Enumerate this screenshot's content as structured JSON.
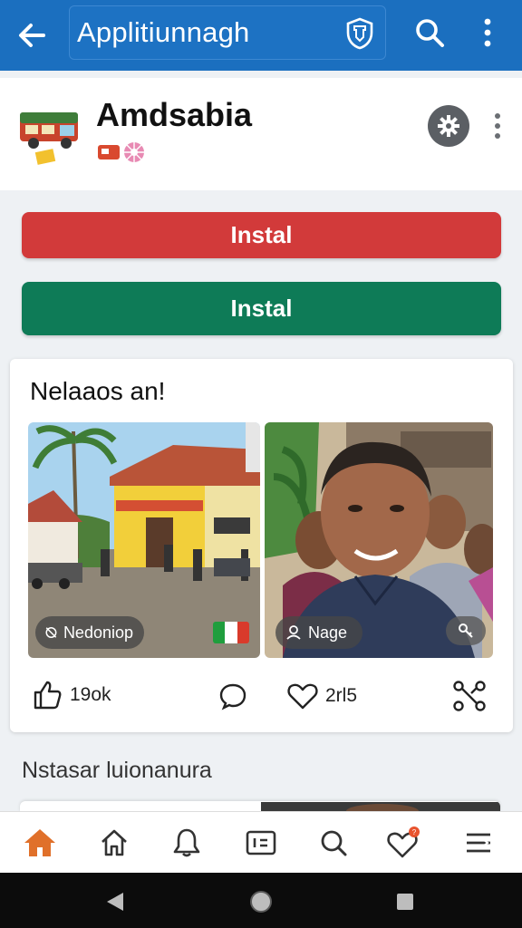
{
  "appbar": {
    "title": "Applitiunnagh",
    "icons": [
      "back-arrow-icon",
      "shield-icon",
      "search-icon",
      "more-vert-icon"
    ]
  },
  "header": {
    "app_name": "Amdsabia",
    "icons": [
      "truck-logo-icon",
      "badge-icons",
      "gear-icon",
      "more-vert-icon"
    ]
  },
  "buttons": {
    "install_primary": "Instal",
    "install_secondary": "Instal"
  },
  "post": {
    "title": "Nelaaos an!",
    "photos": [
      {
        "chip_label": "Nedoniop",
        "chip_icon": "link-off-icon",
        "flag_colors": [
          "#1f9e3d",
          "#ffffff",
          "#d93a2b"
        ]
      },
      {
        "chip_label": "Nage",
        "chip_icon": "people-icon"
      }
    ],
    "actions": {
      "like_count": "19ok",
      "heart_count": "2rl5"
    }
  },
  "section": {
    "title": "Nstasar luionanura"
  },
  "bottom_nav": [
    "home-icon-active",
    "home-icon",
    "bell-icon",
    "media-icon",
    "search-icon",
    "heart-badge-icon",
    "menu-icon"
  ],
  "colors": {
    "appbar": "#1b6fbf",
    "install_red": "#d23a3a",
    "install_green": "#0e7b57",
    "active_nav": "#e0702a",
    "badge": "#e8532e"
  }
}
